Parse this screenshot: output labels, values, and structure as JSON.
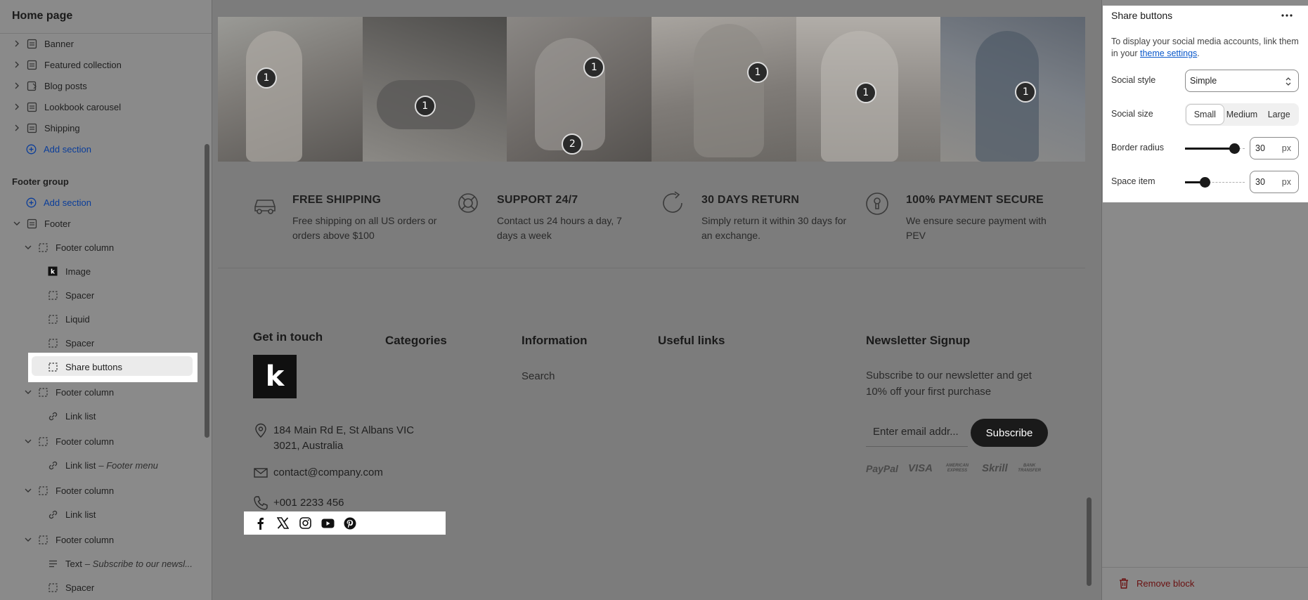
{
  "left_panel": {
    "title": "Home page",
    "top_items": [
      {
        "label": "Banner"
      },
      {
        "label": "Featured collection"
      },
      {
        "label": "Blog posts"
      },
      {
        "label": "Lookbook carousel"
      },
      {
        "label": "Shipping"
      }
    ],
    "add_section_label": "Add section",
    "footer_group_label": "Footer group",
    "footer_add_section_label": "Add section",
    "footer_label": "Footer",
    "footer_columns": [
      {
        "label": "Footer column",
        "children": [
          {
            "label": "Image",
            "icon": "image-icon"
          },
          {
            "label": "Spacer",
            "icon": "block-icon"
          },
          {
            "label": "Liquid",
            "icon": "block-icon"
          },
          {
            "label": "Spacer",
            "icon": "block-icon"
          },
          {
            "label": "Share buttons",
            "icon": "block-icon",
            "selected": true
          }
        ]
      },
      {
        "label": "Footer column",
        "children": [
          {
            "label": "Link list",
            "icon": "link-icon"
          }
        ]
      },
      {
        "label": "Footer column",
        "children": [
          {
            "label": "Link list",
            "suffix": "– Footer menu",
            "icon": "link-icon"
          }
        ]
      },
      {
        "label": "Footer column",
        "children": [
          {
            "label": "Link list",
            "icon": "link-icon"
          }
        ]
      },
      {
        "label": "Footer column",
        "children": [
          {
            "label": "Text",
            "suffix": "– Subscribe to our newsl...",
            "icon": "text-icon"
          },
          {
            "label": "Spacer",
            "icon": "block-icon"
          }
        ]
      }
    ]
  },
  "preview": {
    "hotspots": [
      "1",
      "1",
      "1",
      "2",
      "1",
      "1",
      "1"
    ],
    "features": [
      {
        "title": "FREE SHIPPING",
        "desc": "Free shipping on all US orders or orders above $100",
        "icon": "truck-icon"
      },
      {
        "title": "SUPPORT 24/7",
        "desc": "Contact us 24 hours a day, 7 days a week",
        "icon": "lifebuoy-icon"
      },
      {
        "title": "30 DAYS RETURN",
        "desc": "Simply return it within 30 days for an exchange.",
        "icon": "return-icon"
      },
      {
        "title": "100% PAYMENT SECURE",
        "desc": "We ensure secure payment with PEV",
        "icon": "shield-icon"
      }
    ],
    "footer": {
      "get_in_touch_title": "Get in touch",
      "logo_letter": "k",
      "address": "184 Main Rd E, St Albans VIC 3021, Australia",
      "email": "contact@company.com",
      "phone": "+001 2233 456",
      "social_icons": [
        "facebook-icon",
        "x-icon",
        "instagram-icon",
        "youtube-icon",
        "pinterest-icon"
      ],
      "categories_title": "Categories",
      "information_title": "Information",
      "information_links": [
        "Search"
      ],
      "useful_links_title": "Useful links",
      "newsletter_title": "Newsletter Signup",
      "newsletter_text": "Subscribe to our newsletter and get 10% off your first purchase",
      "email_placeholder": "Enter email addr...",
      "subscribe_label": "Subscribe",
      "payment_methods": [
        "PayPal",
        "VISA",
        "AMERICAN EXPRESS",
        "Skrill",
        "BANK TRANSFER"
      ]
    }
  },
  "right_panel": {
    "title": "Share buttons",
    "desc_prefix": "To display your social media accounts, link them in your ",
    "desc_link": "theme settings",
    "desc_suffix": ".",
    "social_style_label": "Social style",
    "social_style_value": "Simple",
    "social_size_label": "Social size",
    "social_size_options": [
      "Small",
      "Medium",
      "Large"
    ],
    "social_size_selected": "Small",
    "border_radius_label": "Border radius",
    "border_radius_value": "30",
    "border_radius_fraction": 0.9,
    "space_item_label": "Space item",
    "space_item_value": "30",
    "space_item_fraction": 0.3,
    "unit": "px",
    "remove_block_label": "Remove block"
  }
}
